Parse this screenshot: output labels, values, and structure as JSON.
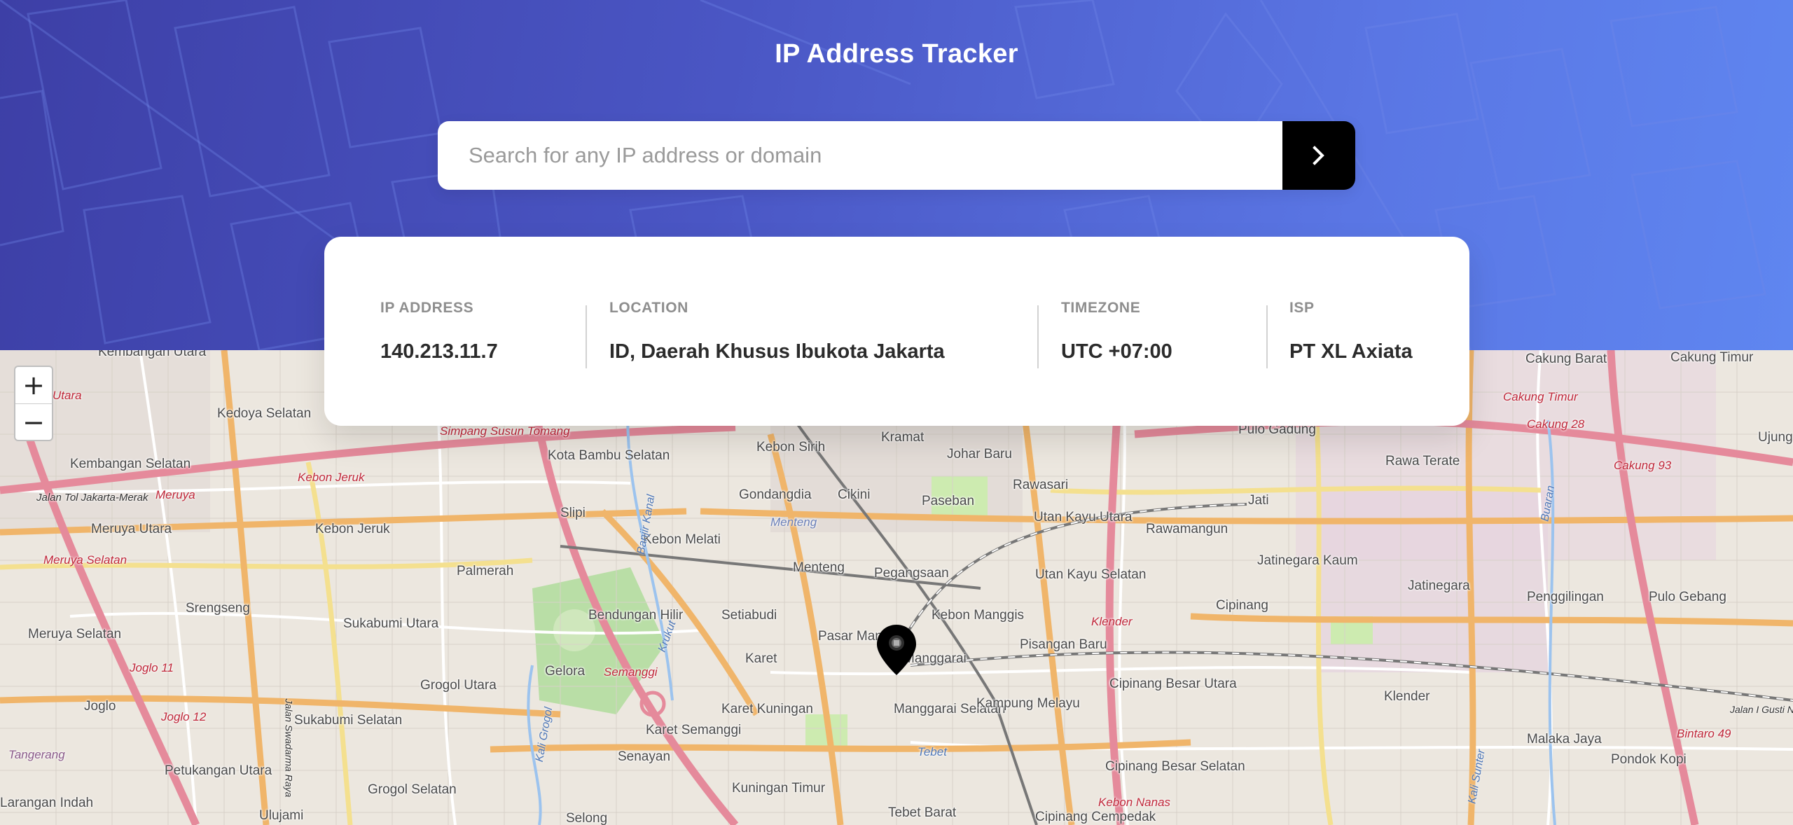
{
  "header": {
    "title": "IP Address Tracker"
  },
  "search": {
    "placeholder": "Search for any IP address or domain",
    "value": "",
    "submit_icon": "chevron-right-icon"
  },
  "info": {
    "ip_label": "IP ADDRESS",
    "ip_value": "140.213.11.7",
    "location_label": "LOCATION",
    "location_value": "ID, Daerah Khusus Ibukota Jakarta",
    "timezone_label": "TIMEZONE",
    "timezone_value": "UTC +07:00",
    "isp_label": "ISP",
    "isp_value": "PT XL Axiata"
  },
  "map": {
    "zoom_in": "+",
    "zoom_out": "−",
    "marker_icon": "location-pin-icon",
    "places": [
      "Kembangan Utara",
      "Kedoya Selatan",
      "Kembangan Selatan",
      "Meruya Utara",
      "Kebon Jeruk",
      "Meruya Selatan",
      "Srengseng",
      "Joglo",
      "Petukangan Utara",
      "Larangan Indah",
      "Ulujami",
      "Sukabumi Utara",
      "Sukabumi Selatan",
      "Grogol Utara",
      "Grogol Selatan",
      "Palmerah",
      "Kota Bambu Selatan",
      "Slipi",
      "Bendungan Hilir",
      "Gelora",
      "Senayan",
      "Karet Semanggi",
      "Setiabudi",
      "Karet",
      "Karet Kuningan",
      "Kuningan Timur",
      "Selong",
      "Tebet Barat",
      "Kebon Sirih",
      "Gondangdia",
      "Cikini",
      "Kebon Melati",
      "Menteng",
      "Pegangsaan",
      "Pasar Manggis",
      "Manggarai",
      "Manggarai Selatan",
      "Kebon Manggis",
      "Kramat",
      "Johar Baru",
      "Paseban",
      "Rawasari",
      "Utan Kayu Utara",
      "Utan Kayu Selatan",
      "Pisangan Baru",
      "Kampung Melayu",
      "Rawamangun",
      "Cipinang Besar Utara",
      "Cipinang Besar Selatan",
      "Cipinang Cempedak",
      "Pulo Gadung",
      "Rawa Terate",
      "Jati",
      "Jatinegara Kaum",
      "Jatinegara",
      "Cipinang",
      "Klender",
      "Penggilingan",
      "Pulo Gebang",
      "Malaka Jaya",
      "Pondok Kopi",
      "Cakung Barat",
      "Cakung Timur",
      "Ujung Me"
    ],
    "roads": [
      "Kebon Jeruk",
      "Meruya",
      "Jalan Tol Jakarta-Merak",
      "Simpang Susun Tomang",
      "Semanggi",
      "Tebet",
      "Klender",
      "Kebon Nanas",
      "Cakung Timur",
      "Cakung 28",
      "Cakung 93",
      "Bintaro 49",
      "Jalan I Gusti Ngurah",
      "Utara",
      "Joglo 11",
      "Joglo 12",
      "Tangerang",
      "Jalan Swadarma Raya",
      "Menteng",
      "Meruya Selatan"
    ],
    "rivers": [
      "Krukut",
      "Kali Grogol",
      "Banjir Kanal",
      "Buaran",
      "Kali Sunter"
    ]
  },
  "colors": {
    "header_start": "#3d3fa6",
    "header_end": "#5f86f0",
    "submit_bg": "#000000",
    "label": "#8e8e8e",
    "value": "#2b2b2b"
  }
}
